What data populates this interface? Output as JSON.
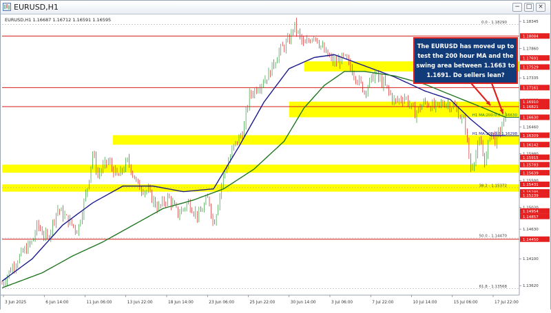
{
  "window": {
    "title": "EURUSD,H1",
    "minimize_glyph": "−",
    "maximize_glyph": "□",
    "close_glyph": "×"
  },
  "header_info": "EURUSD,H1 1.16687 1.16712 1.16591 1.16595",
  "annotation": {
    "text_lines": [
      "The EURUSD has moved up to",
      "test the 200 hour MA and the",
      "swing area between 1.1663 to",
      "1.1691.  Do sellers lean?"
    ],
    "border_color": "#e0201c",
    "fill_color": "#123b7a"
  },
  "colors": {
    "bull": "#2c9a34",
    "bear": "#d91c1c",
    "ma100": "#1a1a8c",
    "ma200": "#207520",
    "zone": "#ffff00",
    "red_line": "#d61a1a"
  },
  "chart_data": {
    "type": "candlestick",
    "symbol": "EURUSD",
    "timeframe": "H1",
    "ylim": [
      1.1345,
      1.1842
    ],
    "y_ticks": [
      "1.18345",
      "1.17860",
      "1.17335",
      "1.16935",
      "1.16460",
      "1.15980",
      "1.15500",
      "1.15020",
      "1.14630",
      "1.14100",
      "1.13620"
    ],
    "x_ticks": [
      "3 Jun 2025",
      "6 Jun 14:00",
      "11 Jun 06:00",
      "13 Jun 22:00",
      "18 Jun 14:00",
      "23 Jun 06:00",
      "25 Jun 22:00",
      "30 Jun 14:00",
      "3 Jul 06:00",
      "7 Jul 22:00",
      "10 Jul 14:00",
      "15 Jul 06:00",
      "17 Jul 22:00"
    ],
    "price_path": [
      [
        0,
        1.1365
      ],
      [
        2,
        1.1395
      ],
      [
        4,
        1.142
      ],
      [
        6,
        1.144
      ],
      [
        7,
        1.147
      ],
      [
        9,
        1.1445
      ],
      [
        11,
        1.15
      ],
      [
        13,
        1.148
      ],
      [
        15,
        1.146
      ],
      [
        17,
        1.154
      ],
      [
        18,
        1.16
      ],
      [
        19,
        1.156
      ],
      [
        21,
        1.1585
      ],
      [
        23,
        1.1555
      ],
      [
        25,
        1.1585
      ],
      [
        27,
        1.154
      ],
      [
        29,
        1.153
      ],
      [
        31,
        1.15
      ],
      [
        33,
        1.152
      ],
      [
        35,
        1.149
      ],
      [
        37,
        1.151
      ],
      [
        39,
        1.1485
      ],
      [
        41,
        1.152
      ],
      [
        42,
        1.147
      ],
      [
        44,
        1.156
      ],
      [
        46,
        1.161
      ],
      [
        48,
        1.164
      ],
      [
        49,
        1.17
      ],
      [
        51,
        1.172
      ],
      [
        53,
        1.174
      ],
      [
        55,
        1.178
      ],
      [
        57,
        1.18
      ],
      [
        58,
        1.1828
      ],
      [
        60,
        1.179
      ],
      [
        62,
        1.1812
      ],
      [
        64,
        1.178
      ],
      [
        66,
        1.176
      ],
      [
        68,
        1.177
      ],
      [
        70,
        1.174
      ],
      [
        72,
        1.171
      ],
      [
        74,
        1.174
      ],
      [
        76,
        1.172
      ],
      [
        78,
        1.169
      ],
      [
        80,
        1.17
      ],
      [
        82,
        1.167
      ],
      [
        84,
        1.169
      ],
      [
        86,
        1.168
      ],
      [
        88,
        1.169
      ],
      [
        90,
        1.168
      ],
      [
        92,
        1.165
      ],
      [
        93,
        1.157
      ],
      [
        95,
        1.162
      ],
      [
        96,
        1.158
      ],
      [
        97,
        1.164
      ],
      [
        98,
        1.162
      ],
      [
        100,
        1.1663
      ]
    ],
    "ma100": {
      "name": "H1 MA:100:0.0",
      "value": "1.16298",
      "path": [
        [
          0,
          1.137
        ],
        [
          6,
          1.141
        ],
        [
          12,
          1.147
        ],
        [
          18,
          1.151
        ],
        [
          24,
          1.154
        ],
        [
          30,
          1.154
        ],
        [
          36,
          1.153
        ],
        [
          42,
          1.1535
        ],
        [
          47,
          1.161
        ],
        [
          52,
          1.169
        ],
        [
          57,
          1.175
        ],
        [
          62,
          1.177
        ],
        [
          66,
          1.1775
        ],
        [
          72,
          1.1755
        ],
        [
          78,
          1.1735
        ],
        [
          84,
          1.171
        ],
        [
          89,
          1.1695
        ],
        [
          93,
          1.166
        ],
        [
          97,
          1.163
        ],
        [
          100,
          1.163
        ]
      ]
    },
    "ma200": {
      "name": "H1 MA:200:0.0",
      "value": "1.16630",
      "path": [
        [
          0,
          1.1358
        ],
        [
          8,
          1.1385
        ],
        [
          14,
          1.1415
        ],
        [
          20,
          1.144
        ],
        [
          26,
          1.147
        ],
        [
          32,
          1.15
        ],
        [
          38,
          1.1515
        ],
        [
          44,
          1.1535
        ],
        [
          50,
          1.157
        ],
        [
          56,
          1.162
        ],
        [
          60,
          1.168
        ],
        [
          64,
          1.172
        ],
        [
          68,
          1.1745
        ],
        [
          72,
          1.1745
        ],
        [
          78,
          1.1737
        ],
        [
          84,
          1.1722
        ],
        [
          90,
          1.17
        ],
        [
          95,
          1.1682
        ],
        [
          100,
          1.1663
        ]
      ]
    },
    "zones": [
      {
        "low": 1.1745,
        "high": 1.1763,
        "start": 60
      },
      {
        "low": 1.1663,
        "high": 1.1691,
        "start": 57
      },
      {
        "low": 1.1614,
        "high": 1.1631,
        "start": 22
      },
      {
        "low": 1.15639,
        "high": 1.15783,
        "start": 0
      },
      {
        "low": 1.153,
        "high": 1.15431,
        "start": 0
      }
    ],
    "red_lines": [
      {
        "price": 1.18084,
        "label": "1.18084"
      },
      {
        "price": 1.17161,
        "label": "1.17161"
      },
      {
        "price": 1.16821,
        "label": "1.16821"
      },
      {
        "price": 1.1445,
        "label": "1.14450"
      }
    ],
    "fib_levels": [
      {
        "label": "0.0 - 1.18290",
        "price": 1.1829
      },
      {
        "label": "38.2 - 1.15372",
        "price": 1.15372
      },
      {
        "label": "50.0 - 1.14470",
        "price": 1.1447
      },
      {
        "label": "61.8 - 1.13568",
        "price": 1.13568
      }
    ],
    "price_labels": [
      {
        "text": "1.18084",
        "price": 1.18084,
        "bg": "#e62020",
        "fg": "#ffffff"
      },
      {
        "text": "1.17691",
        "price": 1.17691,
        "bg": "#e62020",
        "fg": "#ffffff"
      },
      {
        "text": "1.17529",
        "price": 1.17529,
        "bg": "#e62020",
        "fg": "#ffffff"
      },
      {
        "text": "1.17161",
        "price": 1.17161,
        "bg": "#e62020",
        "fg": "#ffffff"
      },
      {
        "text": "1.16910",
        "price": 1.1691,
        "bg": "#e62020",
        "fg": "#ffffff"
      },
      {
        "text": "1.16821",
        "price": 1.16821,
        "bg": "#e62020",
        "fg": "#ffffff"
      },
      {
        "text": "1.16630",
        "price": 1.1663,
        "bg": "#e62020",
        "fg": "#ffffff"
      },
      {
        "text": "1.16309",
        "price": 1.16309,
        "bg": "#e62020",
        "fg": "#ffffff"
      },
      {
        "text": "1.16142",
        "price": 1.16142,
        "bg": "#e62020",
        "fg": "#ffffff"
      },
      {
        "text": "1.15915",
        "price": 1.15915,
        "bg": "#e62020",
        "fg": "#ffffff"
      },
      {
        "text": "1.15783",
        "price": 1.15783,
        "bg": "#e62020",
        "fg": "#ffffff"
      },
      {
        "text": "1.15639",
        "price": 1.15639,
        "bg": "#e62020",
        "fg": "#ffffff"
      },
      {
        "text": "1.15431",
        "price": 1.15431,
        "bg": "#e62020",
        "fg": "#ffffff"
      },
      {
        "text": "1.15295",
        "price": 1.15295,
        "bg": "#e62020",
        "fg": "#ffffff"
      },
      {
        "text": "1.15239",
        "price": 1.15239,
        "bg": "#e62020",
        "fg": "#ffffff"
      },
      {
        "text": "1.14954",
        "price": 1.14954,
        "bg": "#e62020",
        "fg": "#ffffff"
      },
      {
        "text": "1.14857",
        "price": 1.14857,
        "bg": "#e62020",
        "fg": "#ffffff"
      },
      {
        "text": "1.14450",
        "price": 1.1445,
        "bg": "#e62020",
        "fg": "#ffffff"
      }
    ]
  }
}
